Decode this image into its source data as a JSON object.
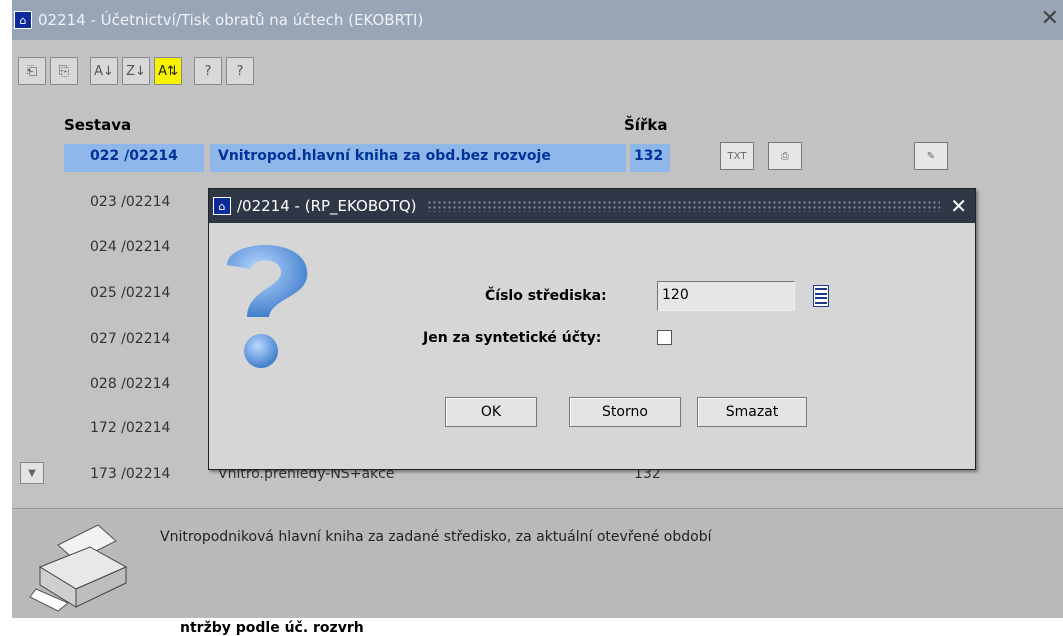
{
  "window": {
    "title": "02214 - Účetnictví/Tisk obratů na účtech (EKOBRTI)",
    "close_glyph": "✕"
  },
  "toolbar": {
    "buttons": [
      {
        "icon": "doc-prev-icon",
        "glyph": "⎗"
      },
      {
        "icon": "doc-next-icon",
        "glyph": "⎘"
      },
      {
        "icon": "sort-asc-icon",
        "glyph": "A↓"
      },
      {
        "icon": "sort-desc-icon",
        "glyph": "Z↓"
      },
      {
        "icon": "sort-toggle-icon",
        "glyph": "A⇅"
      },
      {
        "icon": "help-icon",
        "glyph": "?"
      },
      {
        "icon": "context-help-icon",
        "glyph": "?"
      }
    ]
  },
  "table": {
    "header_sestava": "Sestava",
    "header_sirka": "Šířka",
    "rows": [
      {
        "code": "022 /02214",
        "name": "Vnitropod.hlavní kniha za obd.bez rozvoje",
        "width": "132",
        "selected": true
      },
      {
        "code": "023 /02214",
        "name": "",
        "width": ""
      },
      {
        "code": "024 /02214",
        "name": "",
        "width": ""
      },
      {
        "code": "025 /02214",
        "name": "",
        "width": ""
      },
      {
        "code": "027 /02214",
        "name": "",
        "width": ""
      },
      {
        "code": "028 /02214",
        "name": "",
        "width": ""
      },
      {
        "code": "172 /02214",
        "name": "",
        "width": ""
      },
      {
        "code": "173 /02214",
        "name": "Vnitro.přehledy-NS+akce",
        "width": "132"
      }
    ],
    "row_icons": {
      "txt": "TXT",
      "print": "⎙",
      "edit": "✎"
    }
  },
  "description": "Vnitropodniková hlavní kniha za zadané středisko, za aktuální otevřené období",
  "bottom_text": "ntržby podle úč. rozvrh",
  "dialog": {
    "title": "/02214 - (RP_EKOBOTQ)",
    "close_glyph": "✕",
    "center_label": "Číslo střediska:",
    "center_value": "120",
    "synthetic_label": "Jen za syntetické účty:",
    "ok": "OK",
    "storno": "Storno",
    "smazat": "Smazat"
  }
}
